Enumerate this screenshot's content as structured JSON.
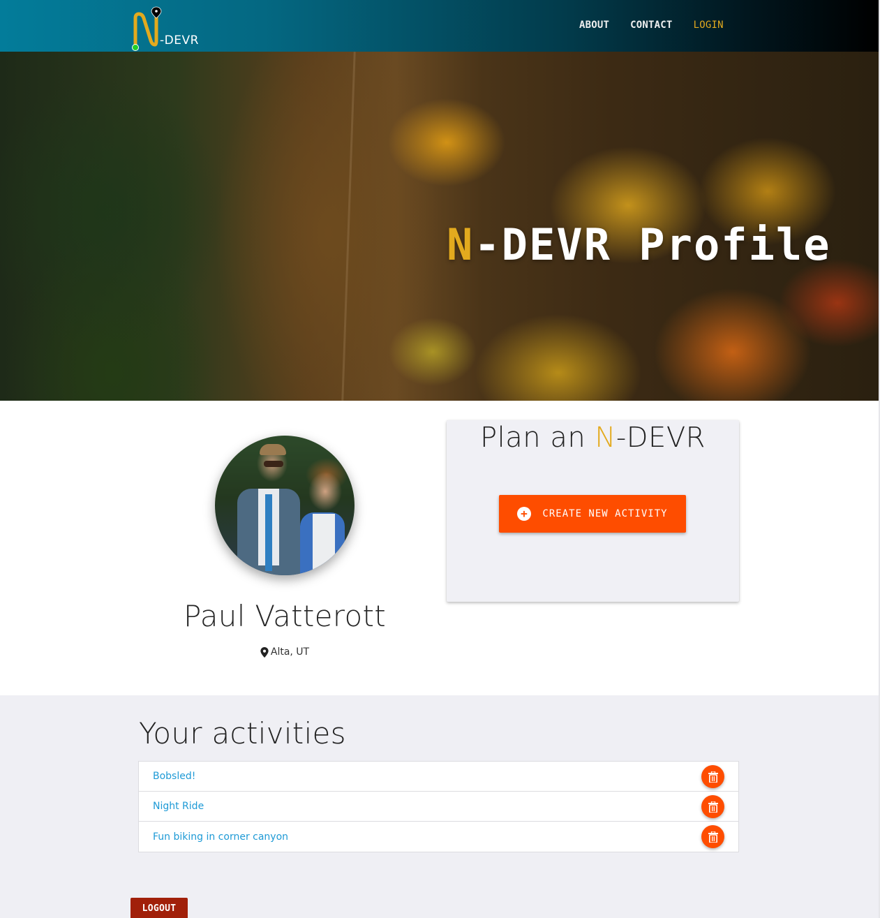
{
  "navbar": {
    "brand_text": "-DEVR",
    "links": [
      {
        "label": "ABOUT"
      },
      {
        "label": "CONTACT"
      },
      {
        "label": "LOGIN"
      }
    ]
  },
  "hero": {
    "title_accent": "N",
    "title_rest": "-DEVR Profile"
  },
  "profile": {
    "name": "Paul Vatterott",
    "location": "Alta, UT",
    "avatar_alt": "Profile photo"
  },
  "plan_card": {
    "title_prefix": "Plan an ",
    "title_accent": "N",
    "title_suffix": "-DEVR",
    "create_button_label": "CREATE NEW ACTIVITY"
  },
  "activities": {
    "title": "Your activities",
    "items": [
      {
        "name": "Bobsled!"
      },
      {
        "name": "Night Ride"
      },
      {
        "name": "Fun biking in corner canyon"
      }
    ]
  },
  "logout_label": "LOGOUT",
  "colors": {
    "accent_gold": "#e3aa1e",
    "action_orange": "#fe4d00",
    "logout_red": "#a1200a",
    "link_blue": "#1e9ad6"
  }
}
